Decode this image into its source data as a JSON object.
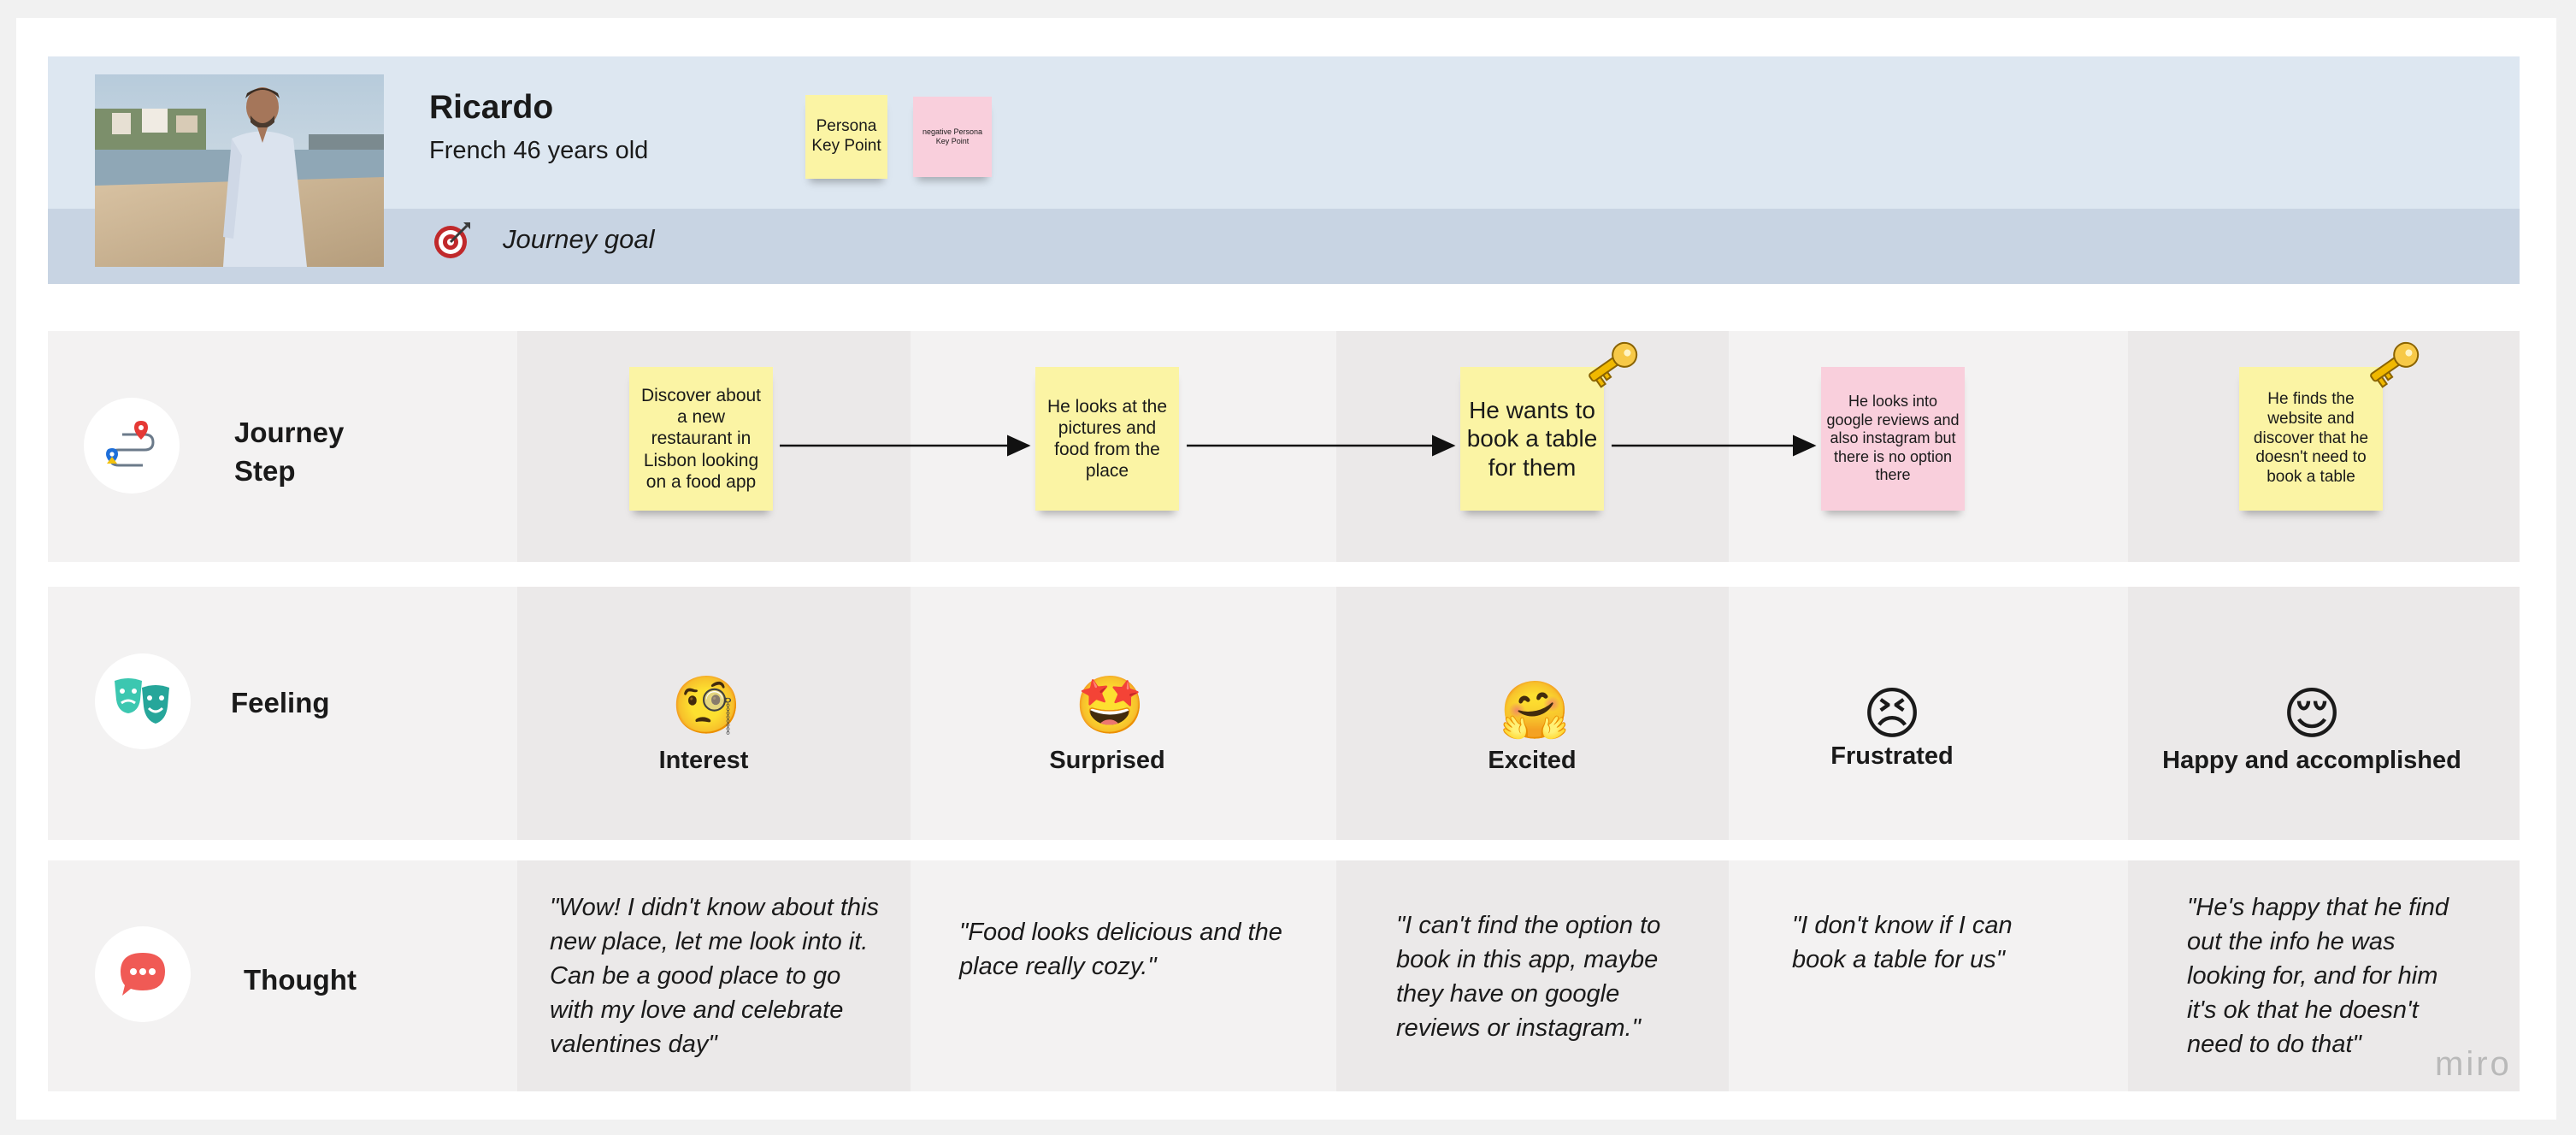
{
  "persona": {
    "name": "Ricardo",
    "subtitle": "French 46 years old",
    "goal": "Journey goal",
    "positive_note": "Persona Key Point",
    "negative_note": "negative Persona Key Point"
  },
  "lanes": {
    "journey_step": "Journey Step",
    "feeling": "Feeling",
    "thought": "Thought"
  },
  "steps": [
    {
      "note": "Discover about a new restaurant in Lisbon looking on a food app",
      "note_color": "yellow",
      "key": false,
      "emoji": "🧐",
      "feeling": "Interest",
      "thought": "\"Wow! I didn't know about this new place, let me look into it. Can be a good place to go with my love and celebrate valentines day\""
    },
    {
      "note": "He looks at the pictures and food from the place",
      "note_color": "yellow",
      "key": false,
      "emoji": "🤩",
      "feeling": "Surprised",
      "thought": "\"Food looks delicious and the place really cozy.\""
    },
    {
      "note": "He wants to book a table for them",
      "note_color": "yellow",
      "key": true,
      "emoji": "🤗",
      "feeling": "Excited",
      "thought": "\"I can't find the option to book in this app, maybe they have on google reviews or instagram.\""
    },
    {
      "note": "He looks into google reviews and also instagram but there is no option there",
      "note_color": "pink",
      "key": false,
      "emoji": "😣",
      "feeling": "Frustrated",
      "thought": "\"I don't know if I can book a table for us\""
    },
    {
      "note": "He finds the website and discover that he doesn't need to book a table",
      "note_color": "yellow",
      "key": true,
      "emoji": "😌",
      "feeling": "Happy and accomplished",
      "thought": "\"He's happy that he find out the info he was looking for, and for him it's ok that he doesn't need to do that\""
    }
  ],
  "icons": {
    "journey": "route-pins-icon",
    "feeling": "theater-masks-icon",
    "thought": "speech-bubble-icon",
    "goal": "target-icon",
    "key": "key-icon"
  },
  "colors": {
    "sticky_yellow": "#fbf4a4",
    "sticky_pink": "#f9cfdc",
    "header_light": "#dde7f1",
    "header_dark": "#c8d4e3"
  },
  "watermark": "miro"
}
